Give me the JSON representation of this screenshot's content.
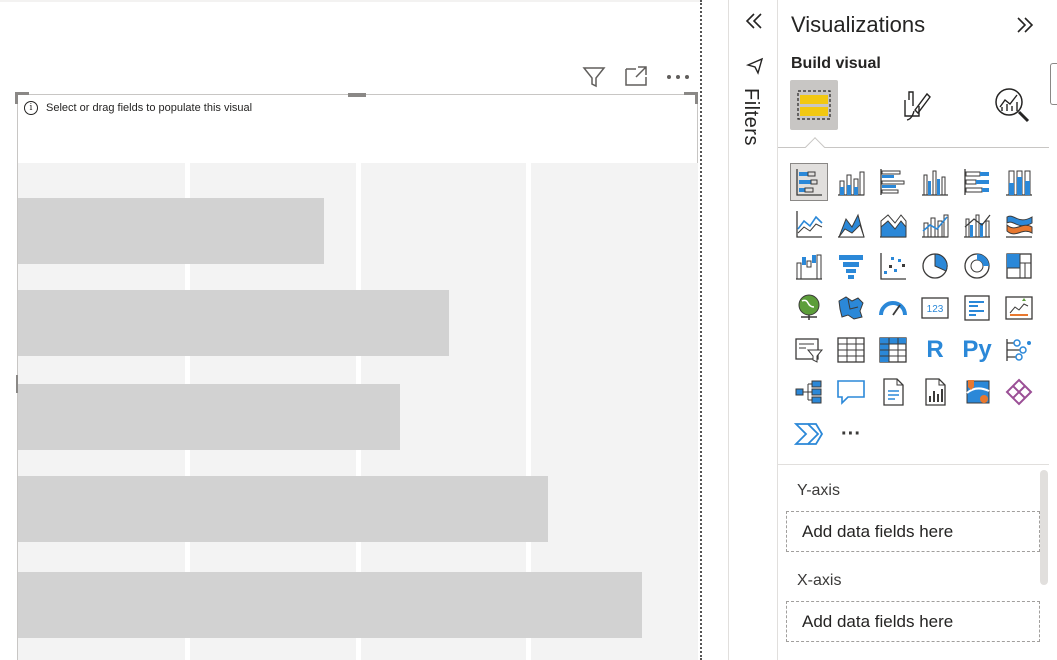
{
  "canvas": {
    "visual_hint": "Select or drag fields to populate this visual",
    "visual_header_icons": [
      "filter-icon",
      "focus-mode-icon",
      "more-options-icon"
    ],
    "placeholder_bars": [
      {
        "fraction": 0.45
      },
      {
        "fraction": 0.634
      },
      {
        "fraction": 0.562
      },
      {
        "fraction": 0.779
      },
      {
        "fraction": 0.918
      }
    ]
  },
  "filters_pane": {
    "label": "Filters",
    "collapse_icon": "double-chevron-left-icon",
    "icon": "filter-icon"
  },
  "visualizations_pane": {
    "title": "Visualizations",
    "expand_icon": "double-chevron-right-icon",
    "build_label": "Build visual",
    "modes": [
      "build-visual-icon",
      "format-visual-icon",
      "analytics-icon"
    ],
    "visual_types": [
      "stacked-bar-chart",
      "stacked-column-chart",
      "clustered-bar-chart",
      "clustered-column-chart",
      "100-stacked-bar-chart",
      "100-stacked-column-chart",
      "line-chart",
      "area-chart",
      "stacked-area-chart",
      "line-and-stacked-column-chart",
      "line-and-clustered-column-chart",
      "ribbon-chart",
      "waterfall-chart",
      "funnel-chart",
      "scatter-chart",
      "pie-chart",
      "donut-chart",
      "treemap",
      "map",
      "filled-map",
      "gauge",
      "card",
      "multi-row-card",
      "kpi",
      "slicer",
      "table",
      "matrix",
      "r-script-visual",
      "python-visual",
      "key-influencers",
      "decomposition-tree",
      "q-and-a",
      "smart-narrative",
      "paginated-report",
      "arcgis-map",
      "power-apps",
      "power-automate",
      "get-more-visuals"
    ],
    "r_label": "R",
    "py_label": "Py",
    "card_label": "123",
    "more_label": "···",
    "wells": [
      {
        "label": "Y-axis",
        "placeholder": "Add data fields here"
      },
      {
        "label": "X-axis",
        "placeholder": "Add data fields here"
      }
    ]
  },
  "colors": {
    "accent_blue": "#2b88d8",
    "accent_yellow": "#f2c811",
    "bar_gray": "#d2d2d2",
    "plot_bg": "#f3f3f3"
  }
}
